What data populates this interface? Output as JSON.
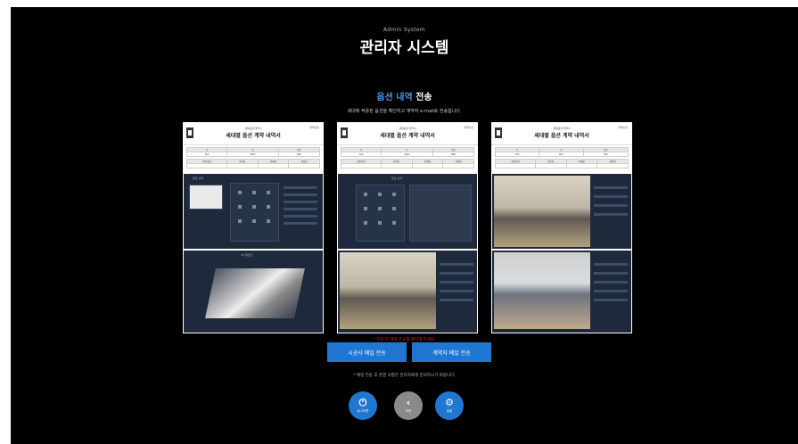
{
  "header": {
    "subtitle": "Admin System",
    "title": "관리자 시스템"
  },
  "section": {
    "title_accent": "옵션 내역",
    "title_rest": " 전송",
    "description": "세대에 적용된 옵션을 확인하고 계약자 e-mail로 전송합니다."
  },
  "documents": [
    {
      "corner": "계약번호",
      "subtitle": "세대옵션계약서",
      "title": "세대별 옵션 계약 내역서",
      "header_row": [
        "동",
        "호",
        "타입"
      ],
      "value_row": [
        "101",
        "1001",
        "84A"
      ],
      "header_row2": [
        "계약자명",
        "연락처",
        "이메일",
        "계약일"
      ],
      "panel_a_label": "평면 선택",
      "panel_b_label": "3D 평면도"
    },
    {
      "corner": "계약번호",
      "subtitle": "세대옵션계약서",
      "title": "세대별 옵션 계약 내역서",
      "header_row": [
        "동",
        "호",
        "타입"
      ],
      "value_row": [
        "102",
        "1203",
        "84B"
      ],
      "header_row2": [
        "계약자명",
        "연락처",
        "이메일",
        "계약일"
      ],
      "panel_a_label": "옵션 선택",
      "panel_b_label": "거실"
    },
    {
      "corner": "계약번호",
      "subtitle": "세대옵션계약서",
      "title": "세대별 옵션 계약 내역서",
      "header_row": [
        "동",
        "호",
        "타입"
      ],
      "value_row": [
        "103",
        "905",
        "59A"
      ],
      "header_row2": [
        "계약자명",
        "연락처",
        "이메일",
        "계약일"
      ],
      "panel_a_label": "현관",
      "panel_b_label": "주방"
    }
  ],
  "notice": "* 전송 전 메일 주소를 확인해 주세요.",
  "buttons": {
    "send_builder": "시공사 메일 전송",
    "send_contractor": "계약자 메일 전송"
  },
  "note": "* 메일 전송 후 변경 사항은 관리자에게 문의하시기 바랍니다.",
  "nav": {
    "logout": "로그아웃",
    "back": "이전",
    "settings": "설정"
  },
  "colors": {
    "accent": "#1f77d1",
    "title_accent": "#4a90e2",
    "notice": "#e02424",
    "background": "#000000"
  }
}
